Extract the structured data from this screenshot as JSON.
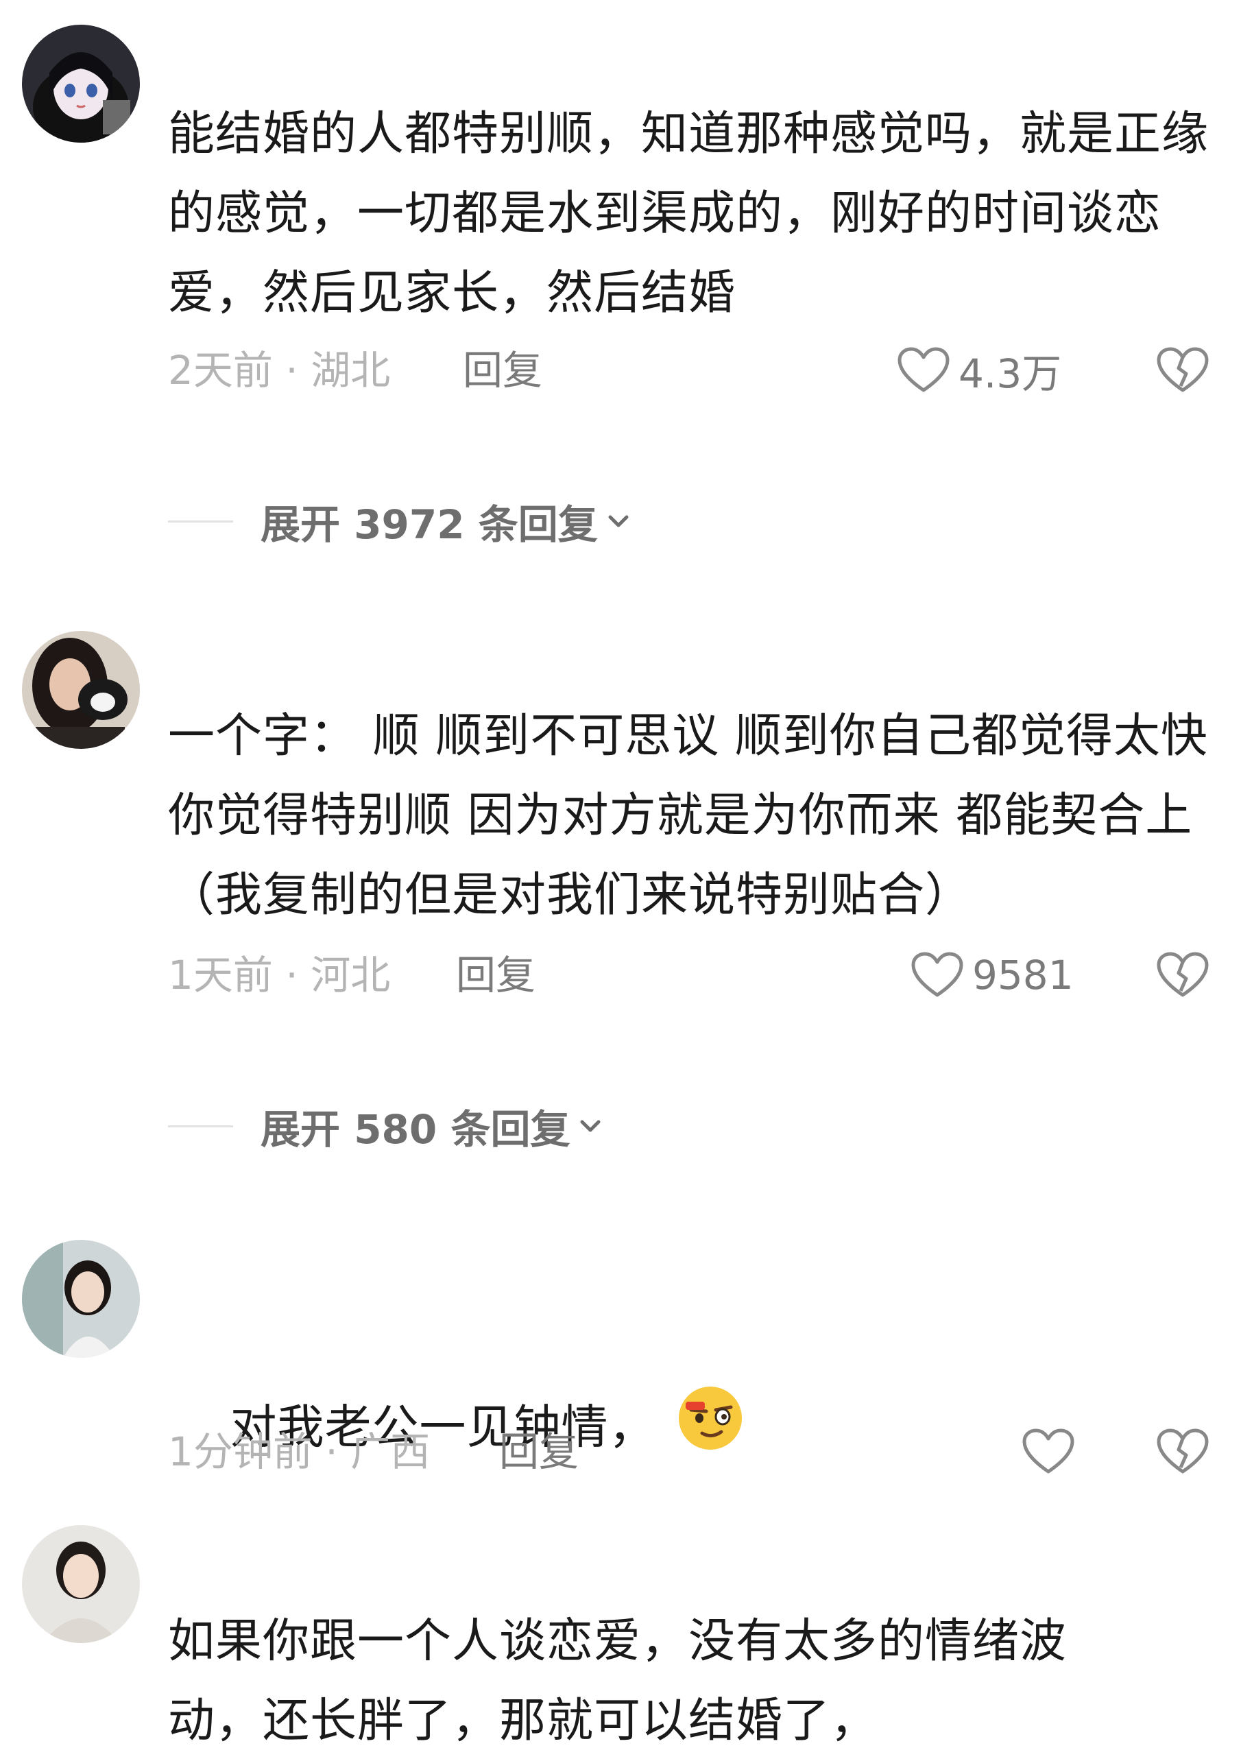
{
  "comments": [
    {
      "text": "能结婚的人都特别顺，知道那种感觉吗，就是正缘的感觉，一切都是水到渠成的，刚好的时间谈恋爱，然后见家长，然后结婚",
      "time_location": "2天前 · 湖北",
      "reply_label": "回复",
      "like_count": "4.3万",
      "expand_label": "展开 3972 条回复",
      "avatar_icon": "anime-girl-avatar"
    },
    {
      "text": "一个字： 顺 顺到不可思议 顺到你自己都觉得太快 你觉得特别顺 因为对方就是为你而来 都能契合上（我复制的但是对我们来说特别贴合）",
      "time_location": "1天前 · 河北",
      "reply_label": "回复",
      "like_count": "9581",
      "expand_label": "展开 580 条回复",
      "avatar_icon": "woman-with-cat-avatar"
    },
    {
      "text": "对我老公一见钟情，",
      "emoji": "blushing-smirk-emoji",
      "time_location": "1分钟前 · 广西",
      "reply_label": "回复",
      "like_count": "",
      "avatar_icon": "woman-photo-avatar"
    },
    {
      "text": "如果你跟一个人谈恋爱，没有太多的情绪波动，还长胖了，那就可以结婚了，",
      "avatar_icon": "woman-portrait-avatar"
    }
  ],
  "colors": {
    "text": "#1a1a1a",
    "meta": "#b4b4b4",
    "action": "#7a7a7a",
    "background": "#ffffff"
  }
}
